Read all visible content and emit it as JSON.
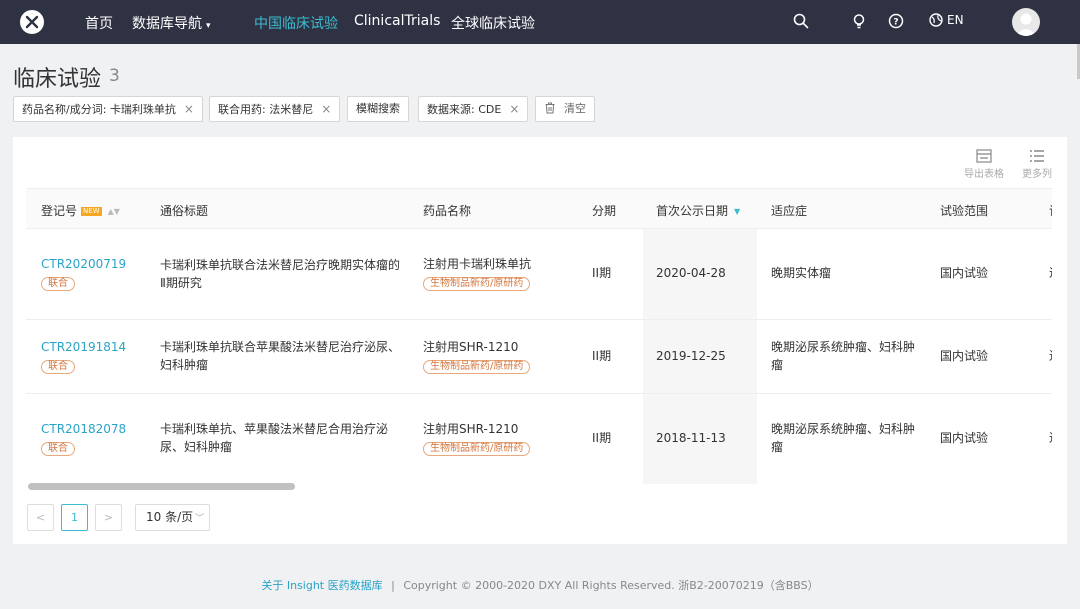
{
  "nav": {
    "home": "首页",
    "db_nav": "数据库导航",
    "cn_trials": "中国临床试验",
    "clinical_trials": "ClinicalTrials",
    "global_trials": "全球临床试验",
    "lang": "EN",
    "accent_color": "#3dbcd1",
    "bar_color": "#2f3243"
  },
  "page": {
    "title": "临床试验",
    "count": "3"
  },
  "filters": [
    {
      "label": "药品名称/成分词: 卡瑞利珠单抗",
      "close": "×"
    },
    {
      "label": "联合用药: 法米替尼",
      "close": "×"
    },
    {
      "label": "模糊搜索"
    },
    {
      "label": "数据来源: CDE",
      "close": "×"
    }
  ],
  "clear_label": "清空",
  "toolbar": {
    "export": "导出表格",
    "more_cols": "更多列"
  },
  "table": {
    "columns": [
      "登记号",
      "通俗标题",
      "药品名称",
      "分期",
      "首次公示日期",
      "适应症",
      "试验范围",
      "试"
    ],
    "new_badge": "NEW",
    "rows": [
      {
        "reg_no": "CTR20200719",
        "tag": "联合",
        "title": "卡瑞利珠单抗联合法米替尼治疗晚期实体瘤的Ⅱ期研究",
        "drug": "注射用卡瑞利珠单抗",
        "drug_tag": "生物制品新药/原研药",
        "phase": "II期",
        "date": "2020-04-28",
        "indication": "晚期实体瘤",
        "scope": "国内试验",
        "extra": "进"
      },
      {
        "reg_no": "CTR20191814",
        "tag": "联合",
        "title": "卡瑞利珠单抗联合苹果酸法米替尼治疗泌尿、妇科肿瘤",
        "drug": "注射用SHR-1210",
        "drug_tag": "生物制品新药/原研药",
        "phase": "II期",
        "date": "2019-12-25",
        "indication": "晚期泌尿系统肿瘤、妇科肿瘤",
        "scope": "国内试验",
        "extra": "进"
      },
      {
        "reg_no": "CTR20182078",
        "tag": "联合",
        "title": "卡瑞利珠单抗、苹果酸法米替尼合用治疗泌尿、妇科肿瘤",
        "drug": "注射用SHR-1210",
        "drug_tag": "生物制品新药/原研药",
        "phase": "II期",
        "date": "2018-11-13",
        "indication": "晚期泌尿系统肿瘤、妇科肿瘤",
        "scope": "国内试验",
        "extra": "进"
      }
    ]
  },
  "pagination": {
    "prev": "<",
    "current": "1",
    "next": ">",
    "page_size": "10 条/页"
  },
  "footer": {
    "about": "关于 Insight 医药数据库",
    "separator": "|",
    "copyright": "Copyright © 2000-2020 DXY All Rights Reserved. 浙B2-20070219（含BBS）"
  }
}
